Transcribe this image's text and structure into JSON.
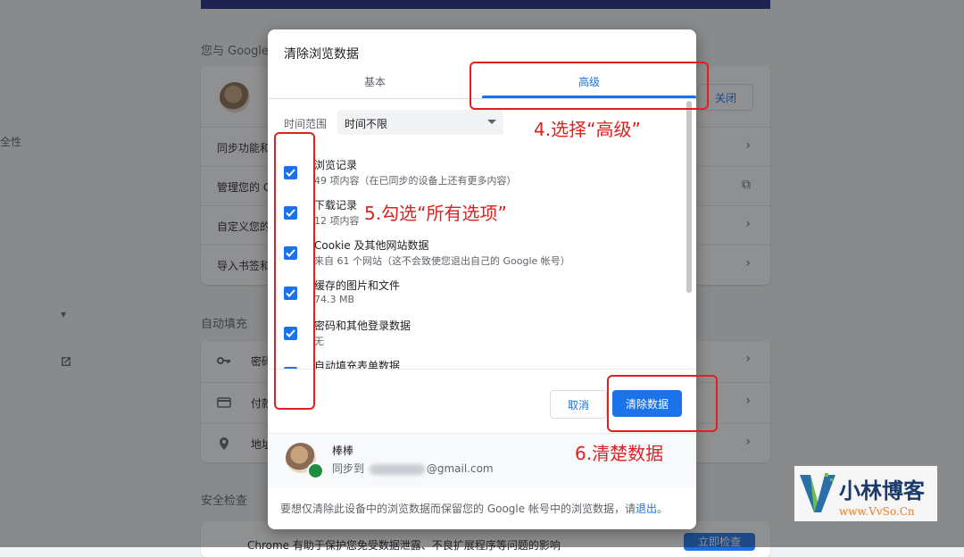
{
  "background": {
    "section_you_google": "您与 Google",
    "left_security": "全性",
    "section_autofill": "自动填充",
    "section_safety": "安全检查",
    "close_button": "关闭",
    "rows_top": [
      "同步功能和",
      "管理您的 G",
      "自定义您的",
      "导入书签和"
    ],
    "rows_autofill": [
      "密码",
      "付款",
      "地址"
    ],
    "safety_text": "Chrome 有助于保护您免受数据泄露、不良扩展程序等问题的影响",
    "safety_button": "立即检查"
  },
  "dialog": {
    "title": "清除浏览数据",
    "tabs": [
      {
        "label": "基本",
        "selected": false
      },
      {
        "label": "高级",
        "selected": true
      }
    ],
    "time_range": {
      "label": "时间范围",
      "value": "时间不限"
    },
    "items": [
      {
        "title": "浏览记录",
        "detail": "49 项内容（在已同步的设备上还有更多内容）",
        "checked": true
      },
      {
        "title": "下载记录",
        "detail": "12 项内容",
        "checked": true
      },
      {
        "title": "Cookie 及其他网站数据",
        "detail": "来自 61 个网站（这不会致使您退出自己的 Google 帐号）",
        "checked": true
      },
      {
        "title": "缓存的图片和文件",
        "detail": "74.3 MB",
        "checked": true
      },
      {
        "title": "密码和其他登录数据",
        "detail": "无",
        "checked": true
      },
      {
        "title": "自动填充表单数据",
        "detail": "",
        "checked": true
      }
    ],
    "cancel_label": "取消",
    "clear_label": "清除数据",
    "account": {
      "name": "棒棒",
      "sync_prefix": "同步到",
      "email_suffix": "@gmail.com"
    },
    "footer_text": "要想仅清除此设备中的浏览数据而保留您的 Google 帐号中的浏览数据，请",
    "footer_link": "退出",
    "footer_end": "。"
  },
  "annotations": {
    "step4": "4.选择“高级”",
    "step5": "5.勾选“所有选项”",
    "step6": "6.清楚数据"
  },
  "watermark": {
    "title": "小林博客",
    "url": "www.VvSo.Cn"
  },
  "colors": {
    "accent": "#1a73e8",
    "annotation": "#e02020"
  }
}
